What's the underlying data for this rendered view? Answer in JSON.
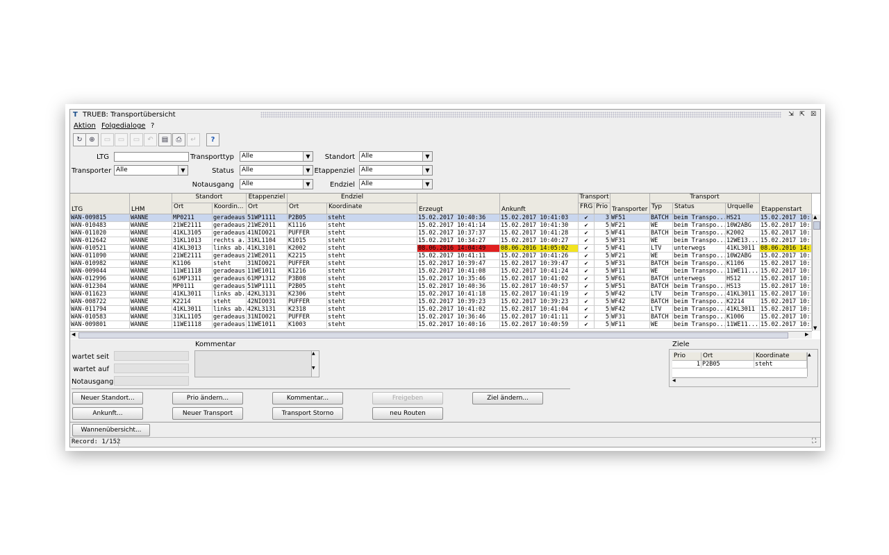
{
  "window": {
    "title": "TRUEB: Transportübersicht",
    "controls": {
      "minimize": "⇲",
      "restore": "⇱",
      "close": "☒"
    }
  },
  "menu": {
    "items": [
      "Aktion",
      "Folgedialoge",
      "?"
    ]
  },
  "toolbar": {
    "buttons": [
      {
        "icon": "refresh-icon",
        "glyph": "↻"
      },
      {
        "icon": "zoom-icon",
        "glyph": "⊕"
      },
      {
        "icon": "new-doc-icon",
        "glyph": "▭"
      },
      {
        "icon": "edit-doc-icon",
        "glyph": "▭"
      },
      {
        "icon": "save-icon",
        "glyph": "▭"
      },
      {
        "icon": "undo-icon",
        "glyph": "↶"
      },
      {
        "icon": "clipboard-icon",
        "glyph": "▤"
      },
      {
        "icon": "print-icon",
        "glyph": "⎙"
      },
      {
        "icon": "return-icon",
        "glyph": "↵"
      },
      {
        "icon": "help-icon",
        "glyph": "?"
      }
    ]
  },
  "filters": {
    "ltg_label": "LTG",
    "ltg_value": "",
    "transporter_label": "Transporter",
    "transporter_value": "Alle",
    "transporttyp_label": "Transporttyp",
    "transporttyp_value": "Alle",
    "status_label": "Status",
    "status_value": "Alle",
    "notausgang_label": "Notausgang",
    "notausgang_value": "Alle",
    "standort_label": "Standort",
    "standort_value": "Alle",
    "etappenziel_label": "Etappenziel",
    "etappenziel_value": "Alle",
    "endziel_label": "Endziel",
    "endziel_value": "Alle"
  },
  "table": {
    "groups": {
      "standort": "Standort",
      "etappenziel": "Etappenziel",
      "endziel": "Endziel",
      "transport1": "Transport",
      "transport2": "Transport"
    },
    "columns": [
      "LTG",
      "LHM",
      "Ort",
      "Koordin...",
      "Ort",
      "Ort",
      "Koordinate",
      "Erzeugt",
      "Ankunft",
      "FRG",
      "Prio",
      "Transporter",
      "Typ",
      "Status",
      "Urquelle",
      "Etappenstart"
    ],
    "rows": [
      [
        "WAN-009815",
        "WANNE",
        "MP0211",
        "geradeaus",
        "51WP1111",
        "P2B05",
        "steht",
        "15.02.2017 10:40:36",
        "15.02.2017 10:41:03",
        "✔",
        "3",
        "WF51",
        "BATCH",
        "beim Transpo...",
        "HS21",
        "15.02.2017 10:"
      ],
      [
        "WAN-010483",
        "WANNE",
        "21WE2111",
        "geradeaus",
        "21WE2011",
        "K1116",
        "steht",
        "15.02.2017 10:41:14",
        "15.02.2017 10:41:30",
        "✔",
        "5",
        "WF21",
        "WE",
        "beim Transpo...",
        "10W2ABG",
        "15.02.2017 10:"
      ],
      [
        "WAN-011020",
        "WANNE",
        "41KL3105",
        "geradeaus",
        "41NIO021",
        "PUFFER",
        "steht",
        "15.02.2017 10:37:37",
        "15.02.2017 10:41:28",
        "✔",
        "5",
        "WF41",
        "BATCH",
        "beim Transpo...",
        "K2002",
        "15.02.2017 10:"
      ],
      [
        "WAN-012642",
        "WANNE",
        "31KL1013",
        "rechts a...",
        "31KL1104",
        "K1015",
        "steht",
        "15.02.2017 10:34:27",
        "15.02.2017 10:40:27",
        "✔",
        "5",
        "WF31",
        "WE",
        "beim Transpo...",
        "12WE13...",
        "15.02.2017 10:"
      ],
      [
        "WAN-010521",
        "WANNE",
        "41KL3013",
        "links ab...",
        "41KL3101",
        "K2002",
        "steht",
        "08.06.2016 14:04:49",
        "08.06.2016 14:05:02",
        "✔",
        "5",
        "WF41",
        "LTV",
        "unterwegs",
        "41KL3011",
        "08.06.2016 14:"
      ],
      [
        "WAN-011090",
        "WANNE",
        "21WE2111",
        "geradeaus",
        "21WE2011",
        "K2215",
        "steht",
        "15.02.2017 10:41:11",
        "15.02.2017 10:41:26",
        "✔",
        "5",
        "WF21",
        "WE",
        "beim Transpo...",
        "10W2ABG",
        "15.02.2017 10:"
      ],
      [
        "WAN-010982",
        "WANNE",
        "K1106",
        "steht",
        "31NIO021",
        "PUFFER",
        "steht",
        "15.02.2017 10:39:47",
        "15.02.2017 10:39:47",
        "✔",
        "5",
        "WF31",
        "BATCH",
        "beim Transpo...",
        "K1106",
        "15.02.2017 10:"
      ],
      [
        "WAN-009044",
        "WANNE",
        "11WE1118",
        "geradeaus",
        "11WE1011",
        "K1216",
        "steht",
        "15.02.2017 10:41:08",
        "15.02.2017 10:41:24",
        "✔",
        "5",
        "WF11",
        "WE",
        "beim Transpo...",
        "11WE11...",
        "15.02.2017 10:"
      ],
      [
        "WAN-012996",
        "WANNE",
        "61MP1311",
        "geradeaus",
        "61MP1312",
        "P3B08",
        "steht",
        "15.02.2017 10:35:46",
        "15.02.2017 10:41:02",
        "✔",
        "5",
        "WF61",
        "BATCH",
        "unterwegs",
        "HS12",
        "15.02.2017 10:"
      ],
      [
        "WAN-012304",
        "WANNE",
        "MP0111",
        "geradeaus",
        "51WP1111",
        "P2B05",
        "steht",
        "15.02.2017 10:40:36",
        "15.02.2017 10:40:57",
        "✔",
        "5",
        "WF51",
        "BATCH",
        "beim Transpo...",
        "HS13",
        "15.02.2017 10:"
      ],
      [
        "WAN-011623",
        "WANNE",
        "41KL3011",
        "links ab...",
        "42KL3131",
        "K2306",
        "steht",
        "15.02.2017 10:41:18",
        "15.02.2017 10:41:19",
        "✔",
        "5",
        "WF42",
        "LTV",
        "beim Transpo...",
        "41KL3011",
        "15.02.2017 10:"
      ],
      [
        "WAN-008722",
        "WANNE",
        "K2214",
        "steht",
        "42NIO031",
        "PUFFER",
        "steht",
        "15.02.2017 10:39:23",
        "15.02.2017 10:39:23",
        "✔",
        "5",
        "WF42",
        "BATCH",
        "beim Transpo...",
        "K2214",
        "15.02.2017 10:"
      ],
      [
        "WAN-011794",
        "WANNE",
        "41KL3011",
        "links ab...",
        "42KL3131",
        "K2318",
        "steht",
        "15.02.2017 10:41:02",
        "15.02.2017 10:41:04",
        "✔",
        "5",
        "WF42",
        "LTV",
        "beim Transpo...",
        "41KL3011",
        "15.02.2017 10:"
      ],
      [
        "WAN-010583",
        "WANNE",
        "31KL1105",
        "geradeaus",
        "31NIO021",
        "PUFFER",
        "steht",
        "15.02.2017 10:36:46",
        "15.02.2017 10:41:11",
        "✔",
        "5",
        "WF31",
        "BATCH",
        "beim Transpo...",
        "K1006",
        "15.02.2017 10:"
      ],
      [
        "WAN-009801",
        "WANNE",
        "11WE1118",
        "geradeaus",
        "11WE1011",
        "K1003",
        "steht",
        "15.02.2017 10:40:16",
        "15.02.2017 10:40:59",
        "✔",
        "5",
        "WF11",
        "WE",
        "beim Transpo...",
        "11WE11...",
        "15.02.2017 10:"
      ]
    ],
    "highlight_colors": {
      "selected": "#c9d6ee",
      "error": "#e02020",
      "warning": "#f2e420"
    }
  },
  "details": {
    "wartet_seit_label": "wartet seit",
    "wartet_auf_label": "wartet auf",
    "notausgang_label": "Notausgang",
    "kommentar_label": "Kommentar"
  },
  "ziele": {
    "title": "Ziele",
    "columns": [
      "Prio",
      "Ort",
      "Koordinate"
    ],
    "rows": [
      [
        "1",
        "P2B05",
        "steht"
      ]
    ]
  },
  "buttons": {
    "neuer_standort": "Neuer Standort...",
    "prio_aendern": "Prio ändern...",
    "kommentar": "Kommentar...",
    "freigeben": "Freigeben",
    "ziel_aendern": "Ziel ändern...",
    "ankunft": "Ankunft...",
    "neuer_transport": "Neuer Transport",
    "transport_storno": "Transport Storno",
    "neu_routen": "neu Routen",
    "wannenuebersicht": "Wannenübersicht..."
  },
  "status": {
    "record": "Record: 1/152"
  }
}
